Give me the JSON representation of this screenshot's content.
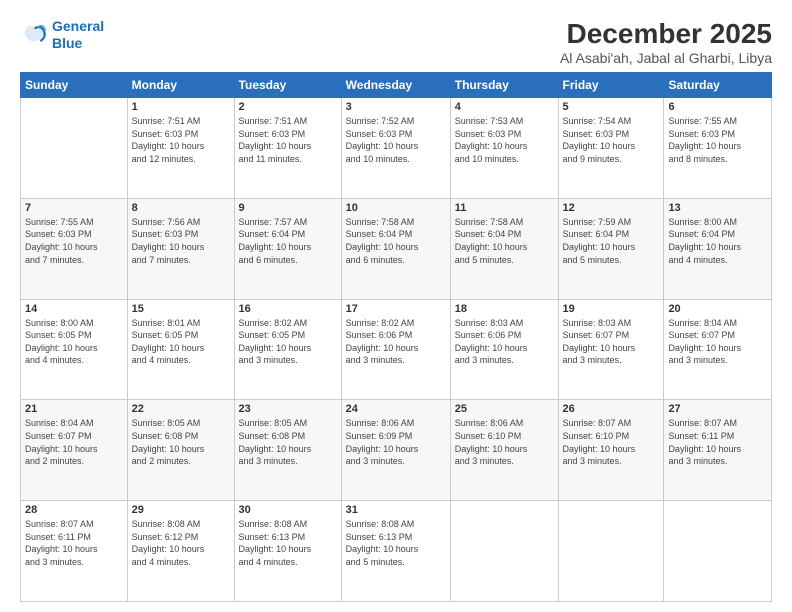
{
  "logo": {
    "line1": "General",
    "line2": "Blue"
  },
  "title": "December 2025",
  "subtitle": "Al Asabi'ah, Jabal al Gharbi, Libya",
  "header": {
    "days": [
      "Sunday",
      "Monday",
      "Tuesday",
      "Wednesday",
      "Thursday",
      "Friday",
      "Saturday"
    ]
  },
  "weeks": [
    [
      {
        "day": "",
        "info": ""
      },
      {
        "day": "1",
        "info": "Sunrise: 7:51 AM\nSunset: 6:03 PM\nDaylight: 10 hours\nand 12 minutes."
      },
      {
        "day": "2",
        "info": "Sunrise: 7:51 AM\nSunset: 6:03 PM\nDaylight: 10 hours\nand 11 minutes."
      },
      {
        "day": "3",
        "info": "Sunrise: 7:52 AM\nSunset: 6:03 PM\nDaylight: 10 hours\nand 10 minutes."
      },
      {
        "day": "4",
        "info": "Sunrise: 7:53 AM\nSunset: 6:03 PM\nDaylight: 10 hours\nand 10 minutes."
      },
      {
        "day": "5",
        "info": "Sunrise: 7:54 AM\nSunset: 6:03 PM\nDaylight: 10 hours\nand 9 minutes."
      },
      {
        "day": "6",
        "info": "Sunrise: 7:55 AM\nSunset: 6:03 PM\nDaylight: 10 hours\nand 8 minutes."
      }
    ],
    [
      {
        "day": "7",
        "info": "Sunrise: 7:55 AM\nSunset: 6:03 PM\nDaylight: 10 hours\nand 7 minutes."
      },
      {
        "day": "8",
        "info": "Sunrise: 7:56 AM\nSunset: 6:03 PM\nDaylight: 10 hours\nand 7 minutes."
      },
      {
        "day": "9",
        "info": "Sunrise: 7:57 AM\nSunset: 6:04 PM\nDaylight: 10 hours\nand 6 minutes."
      },
      {
        "day": "10",
        "info": "Sunrise: 7:58 AM\nSunset: 6:04 PM\nDaylight: 10 hours\nand 6 minutes."
      },
      {
        "day": "11",
        "info": "Sunrise: 7:58 AM\nSunset: 6:04 PM\nDaylight: 10 hours\nand 5 minutes."
      },
      {
        "day": "12",
        "info": "Sunrise: 7:59 AM\nSunset: 6:04 PM\nDaylight: 10 hours\nand 5 minutes."
      },
      {
        "day": "13",
        "info": "Sunrise: 8:00 AM\nSunset: 6:04 PM\nDaylight: 10 hours\nand 4 minutes."
      }
    ],
    [
      {
        "day": "14",
        "info": "Sunrise: 8:00 AM\nSunset: 6:05 PM\nDaylight: 10 hours\nand 4 minutes."
      },
      {
        "day": "15",
        "info": "Sunrise: 8:01 AM\nSunset: 6:05 PM\nDaylight: 10 hours\nand 4 minutes."
      },
      {
        "day": "16",
        "info": "Sunrise: 8:02 AM\nSunset: 6:05 PM\nDaylight: 10 hours\nand 3 minutes."
      },
      {
        "day": "17",
        "info": "Sunrise: 8:02 AM\nSunset: 6:06 PM\nDaylight: 10 hours\nand 3 minutes."
      },
      {
        "day": "18",
        "info": "Sunrise: 8:03 AM\nSunset: 6:06 PM\nDaylight: 10 hours\nand 3 minutes."
      },
      {
        "day": "19",
        "info": "Sunrise: 8:03 AM\nSunset: 6:07 PM\nDaylight: 10 hours\nand 3 minutes."
      },
      {
        "day": "20",
        "info": "Sunrise: 8:04 AM\nSunset: 6:07 PM\nDaylight: 10 hours\nand 3 minutes."
      }
    ],
    [
      {
        "day": "21",
        "info": "Sunrise: 8:04 AM\nSunset: 6:07 PM\nDaylight: 10 hours\nand 2 minutes."
      },
      {
        "day": "22",
        "info": "Sunrise: 8:05 AM\nSunset: 6:08 PM\nDaylight: 10 hours\nand 2 minutes."
      },
      {
        "day": "23",
        "info": "Sunrise: 8:05 AM\nSunset: 6:08 PM\nDaylight: 10 hours\nand 3 minutes."
      },
      {
        "day": "24",
        "info": "Sunrise: 8:06 AM\nSunset: 6:09 PM\nDaylight: 10 hours\nand 3 minutes."
      },
      {
        "day": "25",
        "info": "Sunrise: 8:06 AM\nSunset: 6:10 PM\nDaylight: 10 hours\nand 3 minutes."
      },
      {
        "day": "26",
        "info": "Sunrise: 8:07 AM\nSunset: 6:10 PM\nDaylight: 10 hours\nand 3 minutes."
      },
      {
        "day": "27",
        "info": "Sunrise: 8:07 AM\nSunset: 6:11 PM\nDaylight: 10 hours\nand 3 minutes."
      }
    ],
    [
      {
        "day": "28",
        "info": "Sunrise: 8:07 AM\nSunset: 6:11 PM\nDaylight: 10 hours\nand 3 minutes."
      },
      {
        "day": "29",
        "info": "Sunrise: 8:08 AM\nSunset: 6:12 PM\nDaylight: 10 hours\nand 4 minutes."
      },
      {
        "day": "30",
        "info": "Sunrise: 8:08 AM\nSunset: 6:13 PM\nDaylight: 10 hours\nand 4 minutes."
      },
      {
        "day": "31",
        "info": "Sunrise: 8:08 AM\nSunset: 6:13 PM\nDaylight: 10 hours\nand 5 minutes."
      },
      {
        "day": "",
        "info": ""
      },
      {
        "day": "",
        "info": ""
      },
      {
        "day": "",
        "info": ""
      }
    ]
  ]
}
